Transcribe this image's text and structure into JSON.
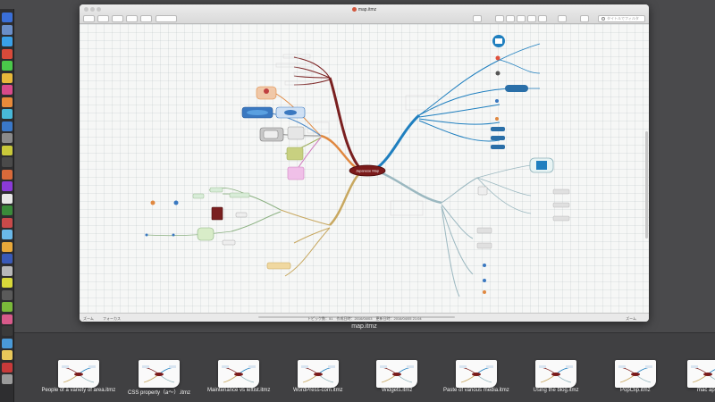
{
  "window": {
    "title": "map.itmz",
    "caption": "map.itmz"
  },
  "toolbar": {
    "search_placeholder": "タイトルでフィルタ"
  },
  "map": {
    "central_topic": "Japanese Map",
    "branch_colors": [
      "#1f7fbf",
      "#5aa8c8",
      "#8ab0a0",
      "#c8a860",
      "#e08840",
      "#7a2020"
    ]
  },
  "statusbar": {
    "left": "ズーム",
    "mode": "フォーカス",
    "info": "トピック数：51　作成日時：2016/04/03　更新日時：2016/04/05 21:04",
    "right": "ズーム"
  },
  "shelf": {
    "files": [
      {
        "label": "People of a variety of area.itmz"
      },
      {
        "label": "CSS property（a～）.itmz"
      },
      {
        "label": "Maintenance vs leftist.itmz"
      },
      {
        "label": "WordPress-com.itmz"
      },
      {
        "label": "Widgets.itmz"
      },
      {
        "label": "Paste of various media.itmz"
      },
      {
        "label": "Using the blog.itmz"
      },
      {
        "label": "PopClip.itmz"
      },
      {
        "label": "mac ap"
      }
    ]
  }
}
